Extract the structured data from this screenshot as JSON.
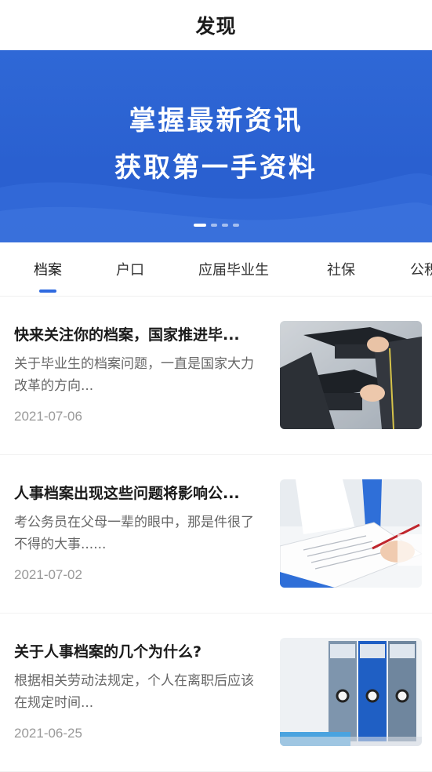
{
  "header": {
    "title": "发现"
  },
  "banner": {
    "line1": "掌握最新资讯",
    "line2": "获取第一手资料",
    "page_count": 4,
    "active_index": 0
  },
  "tabs": [
    {
      "label": "档案",
      "active": true
    },
    {
      "label": "户口",
      "active": false
    },
    {
      "label": "应届毕业生",
      "active": false
    },
    {
      "label": "社保",
      "active": false
    },
    {
      "label": "公积",
      "active": false
    }
  ],
  "articles": [
    {
      "title": "快来关注你的档案，国家推进毕...",
      "summary": "关于毕业生的档案问题，一直是国家大力改革的方向...",
      "date": "2021-07-06",
      "image": "graduation-caps"
    },
    {
      "title": "人事档案出现这些问题将影响公...",
      "summary": "考公务员在父母一辈的眼中，那是件很了不得的大事......",
      "date": "2021-07-02",
      "image": "signing-document"
    },
    {
      "title": "关于人事档案的几个为什么?",
      "summary": "根据相关劳动法规定，个人在离职后应该在规定时间...",
      "date": "2021-06-25",
      "image": "file-binders"
    }
  ],
  "colors": {
    "accent": "#2f6ae0",
    "banner": "#2b62d2"
  }
}
